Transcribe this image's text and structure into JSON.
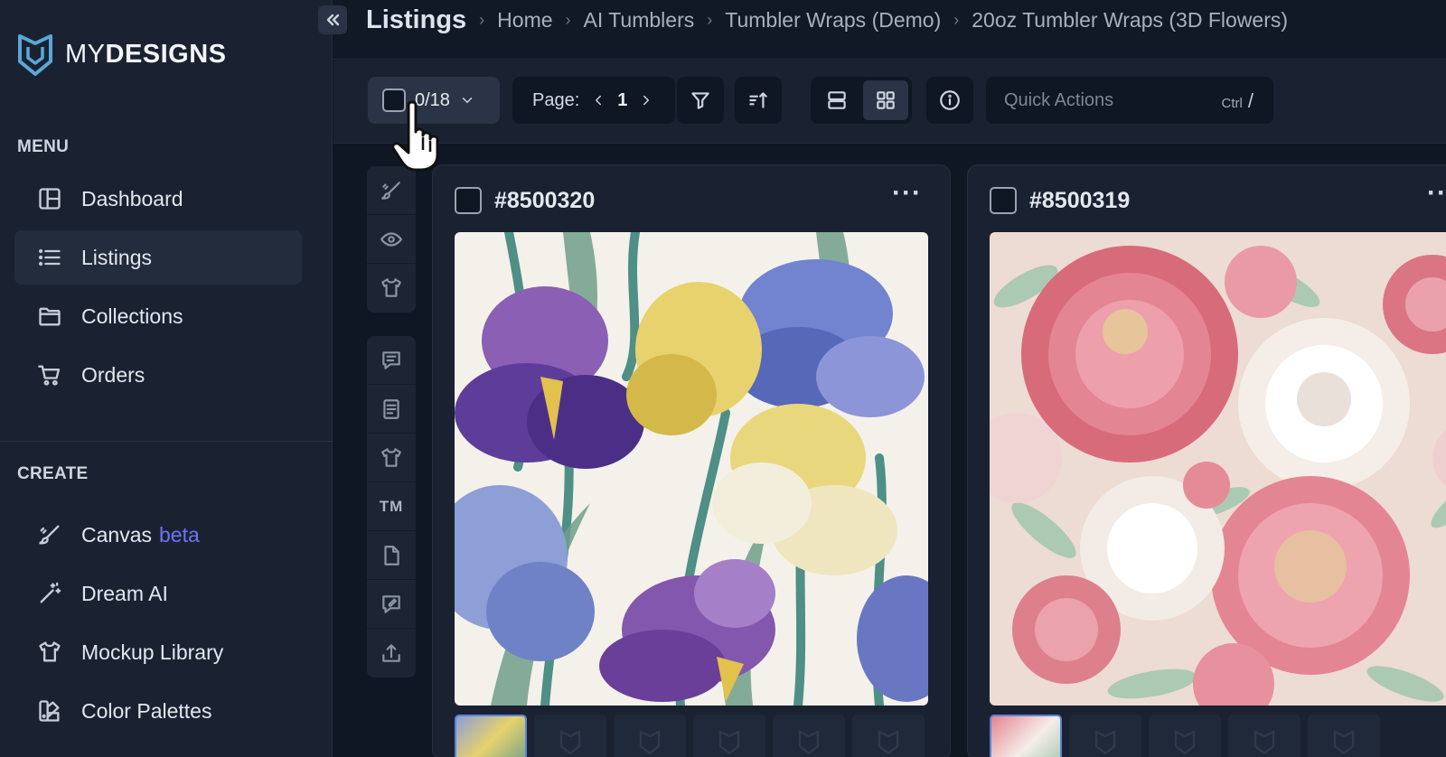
{
  "brand": {
    "name_part1": "MY",
    "name_part2": "DESIGNS"
  },
  "sidebar": {
    "menu_label": "MENU",
    "menu_items": [
      {
        "label": "Dashboard",
        "icon": "layout-icon",
        "active": false
      },
      {
        "label": "Listings",
        "icon": "list-icon",
        "active": true
      },
      {
        "label": "Collections",
        "icon": "folder-icon",
        "active": false
      },
      {
        "label": "Orders",
        "icon": "cart-icon",
        "active": false
      }
    ],
    "create_label": "CREATE",
    "create_items": [
      {
        "label": "Canvas",
        "badge": "beta",
        "icon": "brush-icon"
      },
      {
        "label": "Dream AI",
        "icon": "magic-wand-icon"
      },
      {
        "label": "Mockup Library",
        "icon": "shirt-icon"
      },
      {
        "label": "Color Palettes",
        "icon": "palette-icon"
      }
    ]
  },
  "header": {
    "title": "Listings",
    "breadcrumbs": [
      "Home",
      "AI Tumblers",
      "Tumbler Wraps (Demo)",
      "20oz Tumbler Wraps (3D Flowers)"
    ]
  },
  "toolbar": {
    "selection": "0/18",
    "page_label": "Page:",
    "page_number": "1",
    "quick_actions_placeholder": "Quick Actions",
    "shortcut_mod": "Ctrl",
    "shortcut_key": "/"
  },
  "rail": {
    "trademark_label": "TM"
  },
  "cards": [
    {
      "id": "#8500320",
      "more": "···"
    },
    {
      "id": "#8500319",
      "more": "···"
    }
  ],
  "colors": {
    "accent": "#6d74f5",
    "sidebar_bg": "#1a2232",
    "page_bg": "#0f1624"
  }
}
